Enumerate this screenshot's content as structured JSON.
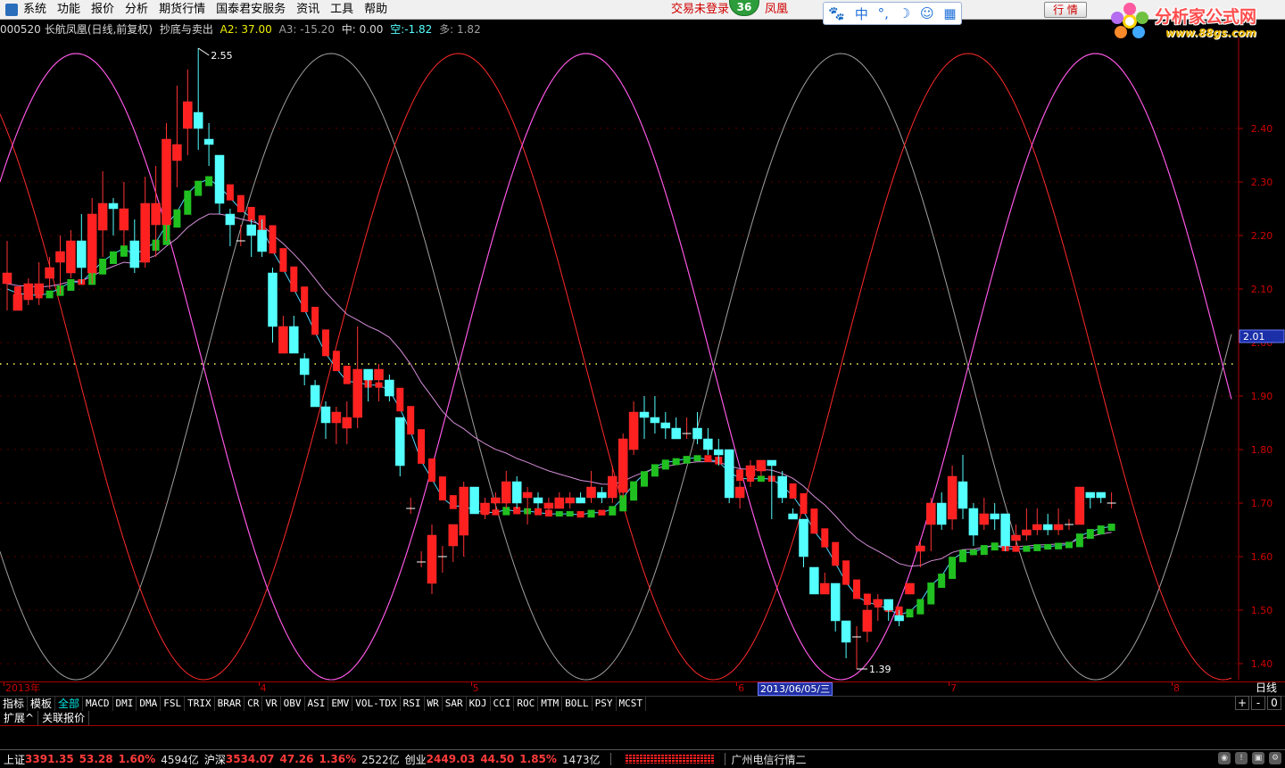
{
  "menu": {
    "items": [
      "系统",
      "功能",
      "报价",
      "分析",
      "期货行情",
      "国泰君安服务",
      "资讯",
      "工具",
      "帮助"
    ]
  },
  "login_status": "交易未登录",
  "login_status_tail": "凤凰",
  "message_count": "36",
  "ime_bar": {
    "icons": [
      "paw-icon",
      "zh-mode-icon",
      "punctuation-icon",
      "moon-icon",
      "user-icon",
      "grid-icon"
    ],
    "zh": "中"
  },
  "quote_button": "行 情",
  "logo": {
    "text": "分析家公式网",
    "url": "www.88gs.com"
  },
  "chart_header": {
    "code": "000520",
    "name": "长航凤凰(日线,前复权)",
    "formula": "抄底与卖出",
    "a2": "A2: 37.00",
    "a3": "A3: -15.20",
    "mid": "中: 0.00",
    "empty_label": "空:",
    "empty_value": "-1.82",
    "long": "多: 1.82"
  },
  "chart_data": {
    "type": "candlestick",
    "title": "000520 长航凤凰(日线,前复权) 抄底与卖出",
    "ylim": [
      1.37,
      2.55
    ],
    "y_ticks": [
      1.4,
      1.5,
      1.6,
      1.7,
      1.8,
      1.9,
      2.0,
      2.1,
      2.2,
      2.3,
      2.4
    ],
    "y_tick_labels": [
      "1.40",
      "1.50",
      "1.60",
      "1.70",
      "1.80",
      "1.90",
      "2.00",
      "2.10",
      "2.20",
      "2.30",
      "2.40"
    ],
    "reference_line": 1.96,
    "price_marker": "2.01",
    "max_label": "2.55",
    "min_label": "1.39",
    "x_labels": [
      {
        "text": "2013年",
        "index": 0
      },
      {
        "text": "4",
        "index": 24
      },
      {
        "text": "5",
        "index": 44
      },
      {
        "text": "6",
        "index": 69
      },
      {
        "text": "7",
        "index": 89
      },
      {
        "text": "8",
        "index": 110
      }
    ],
    "cursor_date": "2013/06/05/三",
    "period": "日线",
    "candles": [
      [
        2.11,
        2.13,
        2.06,
        2.19
      ],
      [
        2.06,
        2.09,
        2.07,
        2.1
      ],
      [
        2.08,
        2.11,
        2.07,
        2.12
      ],
      [
        2.09,
        2.11,
        2.07,
        2.15
      ],
      [
        2.12,
        2.14,
        2.1,
        2.16
      ],
      [
        2.15,
        2.17,
        2.09,
        2.2
      ],
      [
        2.13,
        2.19,
        2.12,
        2.21
      ],
      [
        2.19,
        2.14,
        2.11,
        2.24
      ],
      [
        2.13,
        2.24,
        2.11,
        2.27
      ],
      [
        2.21,
        2.26,
        2.16,
        2.32
      ],
      [
        2.26,
        2.25,
        2.2,
        2.27
      ],
      [
        2.21,
        2.25,
        2.18,
        2.3
      ],
      [
        2.19,
        2.14,
        2.13,
        2.23
      ],
      [
        2.15,
        2.26,
        2.14,
        2.31
      ],
      [
        2.22,
        2.26,
        2.16,
        2.33
      ],
      [
        2.22,
        2.38,
        2.19,
        2.41
      ],
      [
        2.34,
        2.37,
        2.29,
        2.48
      ],
      [
        2.4,
        2.45,
        2.35,
        2.51
      ],
      [
        2.43,
        2.4,
        2.36,
        2.55
      ],
      [
        2.38,
        2.37,
        2.33,
        2.41
      ],
      [
        2.35,
        2.26,
        2.24,
        2.35
      ],
      [
        2.24,
        2.22,
        2.18,
        2.25
      ],
      [
        2.19,
        2.19,
        2.18,
        2.22
      ],
      [
        2.22,
        2.2,
        2.16,
        2.23
      ],
      [
        2.21,
        2.17,
        2.16,
        2.23
      ],
      [
        2.13,
        2.03,
        2.0,
        2.14
      ],
      [
        1.98,
        2.03,
        1.98,
        2.05
      ],
      [
        2.03,
        1.98,
        1.98,
        2.05
      ],
      [
        1.97,
        1.94,
        1.92,
        1.98
      ],
      [
        1.92,
        1.88,
        1.88,
        1.93
      ],
      [
        1.88,
        1.85,
        1.82,
        1.89
      ],
      [
        1.85,
        1.87,
        1.81,
        1.88
      ],
      [
        1.84,
        1.86,
        1.81,
        1.89
      ],
      [
        1.86,
        1.95,
        1.84,
        2.03
      ],
      [
        1.95,
        1.93,
        1.89,
        1.95
      ],
      [
        1.93,
        1.95,
        1.89,
        1.96
      ],
      [
        1.93,
        1.9,
        1.89,
        1.94
      ],
      [
        1.86,
        1.77,
        1.75,
        1.86
      ],
      [
        1.69,
        1.69,
        1.68,
        1.71
      ],
      [
        1.59,
        1.59,
        1.58,
        1.61
      ],
      [
        1.55,
        1.64,
        1.53,
        1.66
      ],
      [
        1.6,
        1.6,
        1.57,
        1.62
      ],
      [
        1.62,
        1.66,
        1.59,
        1.65
      ],
      [
        1.64,
        1.73,
        1.6,
        1.74
      ],
      [
        1.73,
        1.68,
        1.68,
        1.73
      ],
      [
        1.68,
        1.7,
        1.67,
        1.71
      ],
      [
        1.7,
        1.71,
        1.68,
        1.72
      ],
      [
        1.7,
        1.74,
        1.69,
        1.76
      ],
      [
        1.74,
        1.7,
        1.69,
        1.75
      ],
      [
        1.71,
        1.72,
        1.66,
        1.73
      ],
      [
        1.71,
        1.7,
        1.69,
        1.72
      ],
      [
        1.69,
        1.7,
        1.68,
        1.71
      ],
      [
        1.69,
        1.71,
        1.69,
        1.72
      ],
      [
        1.7,
        1.71,
        1.69,
        1.72
      ],
      [
        1.71,
        1.7,
        1.7,
        1.72
      ],
      [
        1.71,
        1.73,
        1.7,
        1.76
      ],
      [
        1.72,
        1.71,
        1.7,
        1.73
      ],
      [
        1.71,
        1.75,
        1.7,
        1.77
      ],
      [
        1.72,
        1.82,
        1.71,
        1.83
      ],
      [
        1.8,
        1.87,
        1.79,
        1.89
      ],
      [
        1.87,
        1.86,
        1.82,
        1.9
      ],
      [
        1.86,
        1.85,
        1.83,
        1.9
      ],
      [
        1.85,
        1.84,
        1.82,
        1.87
      ],
      [
        1.84,
        1.82,
        1.82,
        1.86
      ],
      [
        1.83,
        1.83,
        1.82,
        1.86
      ],
      [
        1.84,
        1.82,
        1.81,
        1.87
      ],
      [
        1.82,
        1.8,
        1.79,
        1.84
      ],
      [
        1.8,
        1.79,
        1.77,
        1.82
      ],
      [
        1.8,
        1.71,
        1.7,
        1.8
      ],
      [
        1.71,
        1.73,
        1.69,
        1.74
      ],
      [
        1.75,
        1.77,
        1.73,
        1.78
      ],
      [
        1.76,
        1.78,
        1.75,
        1.78
      ],
      [
        1.78,
        1.77,
        1.67,
        1.78
      ],
      [
        1.75,
        1.71,
        1.7,
        1.76
      ],
      [
        1.68,
        1.67,
        1.67,
        1.69
      ],
      [
        1.67,
        1.6,
        1.58,
        1.67
      ],
      [
        1.58,
        1.53,
        1.53,
        1.57
      ],
      [
        1.53,
        1.55,
        1.53,
        1.57
      ],
      [
        1.55,
        1.48,
        1.46,
        1.55
      ],
      [
        1.48,
        1.44,
        1.41,
        1.48
      ],
      [
        1.45,
        1.45,
        1.39,
        1.47
      ],
      [
        1.46,
        1.5,
        1.44,
        1.51
      ],
      [
        1.51,
        1.52,
        1.48,
        1.53
      ],
      [
        1.52,
        1.5,
        1.48,
        1.52
      ],
      [
        1.49,
        1.48,
        1.47,
        1.5
      ],
      [
        1.53,
        1.55,
        1.53,
        1.55
      ],
      [
        1.61,
        1.62,
        1.58,
        1.63
      ],
      [
        1.66,
        1.7,
        1.61,
        1.71
      ],
      [
        1.7,
        1.66,
        1.65,
        1.72
      ],
      [
        1.67,
        1.75,
        1.65,
        1.77
      ],
      [
        1.74,
        1.69,
        1.67,
        1.79
      ],
      [
        1.69,
        1.64,
        1.62,
        1.7
      ],
      [
        1.66,
        1.68,
        1.65,
        1.71
      ],
      [
        1.68,
        1.67,
        1.65,
        1.7
      ],
      [
        1.68,
        1.62,
        1.61,
        1.68
      ],
      [
        1.63,
        1.64,
        1.62,
        1.66
      ],
      [
        1.64,
        1.65,
        1.63,
        1.69
      ],
      [
        1.65,
        1.66,
        1.64,
        1.69
      ],
      [
        1.66,
        1.65,
        1.64,
        1.68
      ],
      [
        1.65,
        1.66,
        1.64,
        1.69
      ],
      [
        1.66,
        1.66,
        1.65,
        1.67
      ],
      [
        1.66,
        1.73,
        1.66,
        1.73
      ],
      [
        1.72,
        1.71,
        1.69,
        1.72
      ],
      [
        1.72,
        1.71,
        1.7,
        1.72
      ],
      [
        1.7,
        1.7,
        1.69,
        1.72
      ]
    ],
    "series": [
      {
        "kind": "sine",
        "color": "#ffff40",
        "min": 1.37,
        "max": 2.54,
        "period_bars": 48,
        "phase_bars": 6.5
      },
      {
        "kind": "sine",
        "color": "#a0a0a0",
        "min": 1.37,
        "max": 2.54,
        "period_bars": 48,
        "phase_bars": 30.5
      },
      {
        "kind": "sine",
        "color": "#ff2a2a",
        "min": 1.37,
        "max": 2.54,
        "period_bars": 48,
        "phase_bars": 42.5
      },
      {
        "kind": "sine",
        "color": "#ff40ff",
        "min": 1.37,
        "max": 2.54,
        "period_bars": 48,
        "phase_bars": 54.5
      }
    ],
    "bands": {
      "green_color": "#20c020",
      "red_color": "#ff2020",
      "cyan_color": "#4fd8ff",
      "pink_color": "#d58ed8"
    }
  },
  "indicator_tabs": [
    "指标",
    "模板",
    "全部",
    "MACD",
    "DMI",
    "DMA",
    "FSL",
    "TRIX",
    "BRAR",
    "CR",
    "VR",
    "OBV",
    "ASI",
    "EMV",
    "VOL-TDX",
    "RSI",
    "WR",
    "SAR",
    "KDJ",
    "CCI",
    "ROC",
    "MTM",
    "BOLL",
    "PSY",
    "MCST"
  ],
  "tab_controls": [
    "+",
    "-",
    "0"
  ],
  "ext_tabs": [
    "扩展^",
    "关联报价"
  ],
  "status_bar": {
    "sh_label": "上证",
    "sh_value": "3391.35",
    "sh_change": "53.28",
    "sh_pct": "1.60%",
    "sh_amount": "4594亿",
    "hs_label": "沪深",
    "hs_value": "3534.07",
    "hs_change": "47.26",
    "hs_pct": "1.36%",
    "hs_amount": "2522亿",
    "cy_label": "创业",
    "cy_value": "2449.03",
    "cy_change": "44.50",
    "cy_pct": "1.85%",
    "cy_amount": "1473亿",
    "feed": "广州电信行情二"
  }
}
